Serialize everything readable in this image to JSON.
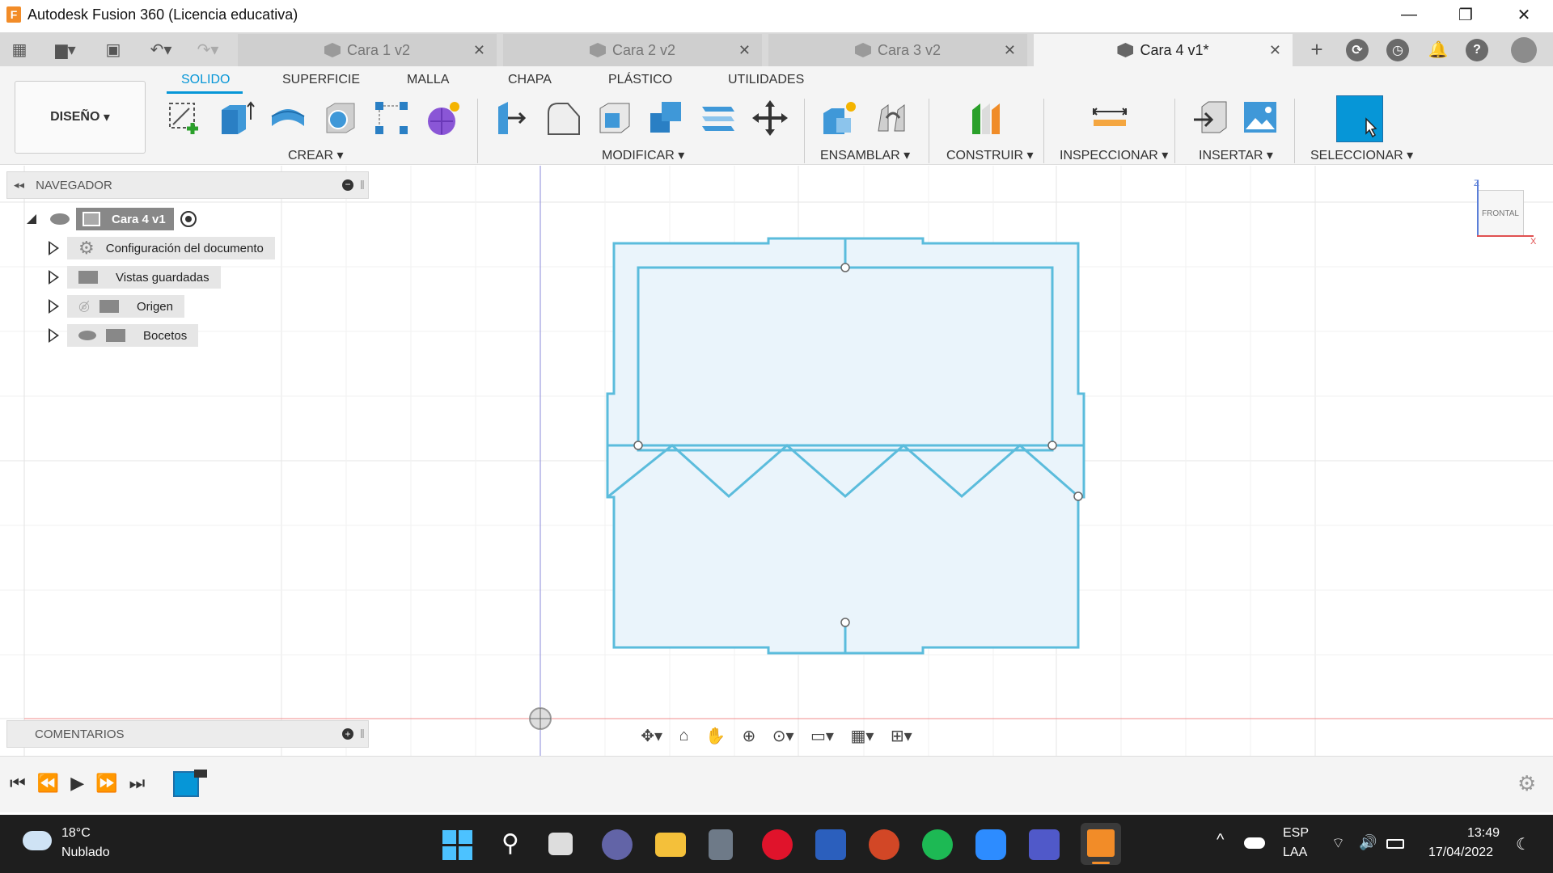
{
  "window": {
    "title": "Autodesk Fusion 360 (Licencia educativa)",
    "logo_letter": "F"
  },
  "doc_tabs": [
    {
      "label": "Cara 1 v2",
      "active": false
    },
    {
      "label": "Cara 2 v2",
      "active": false
    },
    {
      "label": "Cara 3 v2",
      "active": false
    },
    {
      "label": "Cara 4 v1*",
      "active": true
    }
  ],
  "toolbar": {
    "workspace_button": "DISEÑO",
    "workspace_tabs": [
      "SOLIDO",
      "SUPERFICIE",
      "MALLA",
      "CHAPA",
      "PLÁSTICO",
      "UTILIDADES"
    ],
    "active_tab": "SOLIDO",
    "groups": [
      "CREAR",
      "MODIFICAR",
      "ENSAMBLAR",
      "CONSTRUIR",
      "INSPECCIONAR",
      "INSERTAR",
      "SELECCIONAR"
    ]
  },
  "browser": {
    "header": "NAVEGADOR",
    "root": "Cara 4 v1",
    "items": [
      "Configuración del documento",
      "Vistas guardadas",
      "Origen",
      "Bocetos"
    ]
  },
  "comments": {
    "header": "COMENTARIOS"
  },
  "viewcube": {
    "face": "FRONTAL",
    "axis_z": "Z",
    "axis_x": "X"
  },
  "taskbar": {
    "weather_temp": "18°C",
    "weather_desc": "Nublado",
    "lang_top": "ESP",
    "lang_bottom": "LAA",
    "time": "13:49",
    "date": "17/04/2022"
  },
  "colors": {
    "accent": "#0696d7",
    "sketch": "#5bbcdc",
    "sketch_fill": "#eaf4fb",
    "axis_red": "#f08c8c",
    "axis_blue": "#8a8ad8"
  }
}
